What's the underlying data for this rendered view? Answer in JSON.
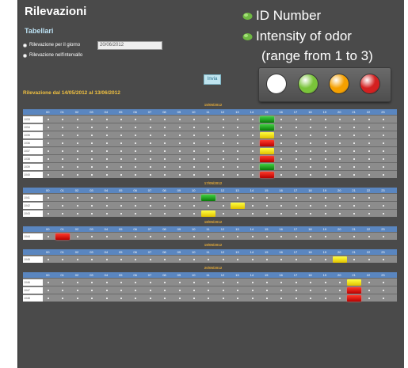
{
  "app": {
    "title": "Rilevazioni",
    "subnav": "Tabellari",
    "option_day": "Rilevazione per il giorno",
    "option_interval": "Rilevazione nell'intervallo",
    "date_value": "20/06/2012",
    "submit_label": "Invia",
    "range_label": "Rilevazione dal 14/05/2012 al 13/06/2012"
  },
  "legend": {
    "id_label": "ID Number",
    "intensity_label": "Intensity of odor",
    "range_note": "(range from 1 to 3)",
    "light_colors": [
      "#ffffff",
      "#7ac43a",
      "#f5a000",
      "#d42020"
    ]
  },
  "hours": [
    "00",
    "01",
    "02",
    "03",
    "04",
    "05",
    "06",
    "07",
    "08",
    "09",
    "10",
    "11",
    "12",
    "13",
    "14",
    "15",
    "16",
    "17",
    "18",
    "19",
    "20",
    "21",
    "22",
    "23"
  ],
  "days": [
    {
      "date": "15/05/2012",
      "rows": [
        {
          "id": "1033",
          "marks": [
            {
              "hour": 15,
              "level": "green"
            }
          ]
        },
        {
          "id": "1034",
          "marks": [
            {
              "hour": 15,
              "level": "green"
            }
          ]
        },
        {
          "id": "1035",
          "marks": [
            {
              "hour": 15,
              "level": "yellow"
            }
          ]
        },
        {
          "id": "1036",
          "marks": [
            {
              "hour": 15,
              "level": "red"
            }
          ]
        },
        {
          "id": "1037",
          "marks": [
            {
              "hour": 15,
              "level": "yellow"
            }
          ]
        },
        {
          "id": "1038",
          "marks": [
            {
              "hour": 15,
              "level": "red"
            }
          ]
        },
        {
          "id": "1039",
          "marks": [
            {
              "hour": 15,
              "level": "green"
            }
          ]
        },
        {
          "id": "1040",
          "marks": [
            {
              "hour": 15,
              "level": "red"
            }
          ]
        }
      ]
    },
    {
      "date": "17/05/2012",
      "rows": [
        {
          "id": "1041",
          "marks": [
            {
              "hour": 11,
              "level": "green"
            }
          ]
        },
        {
          "id": "1042",
          "marks": [
            {
              "hour": 13,
              "level": "yellow"
            }
          ]
        },
        {
          "id": "1043",
          "marks": [
            {
              "hour": 11,
              "level": "yellow"
            }
          ]
        }
      ]
    },
    {
      "date": "18/05/2012",
      "rows": [
        {
          "id": "1044",
          "marks": [
            {
              "hour": 1,
              "level": "red"
            }
          ]
        }
      ]
    },
    {
      "date": "19/05/2012",
      "rows": [
        {
          "id": "1045",
          "marks": [
            {
              "hour": 20,
              "level": "yellow"
            }
          ]
        }
      ]
    },
    {
      "date": "20/05/2012",
      "rows": [
        {
          "id": "1046",
          "marks": [
            {
              "hour": 21,
              "level": "yellow"
            }
          ]
        },
        {
          "id": "1047",
          "marks": [
            {
              "hour": 21,
              "level": "red"
            }
          ]
        },
        {
          "id": "1048",
          "marks": [
            {
              "hour": 21,
              "level": "red"
            }
          ]
        }
      ]
    }
  ]
}
